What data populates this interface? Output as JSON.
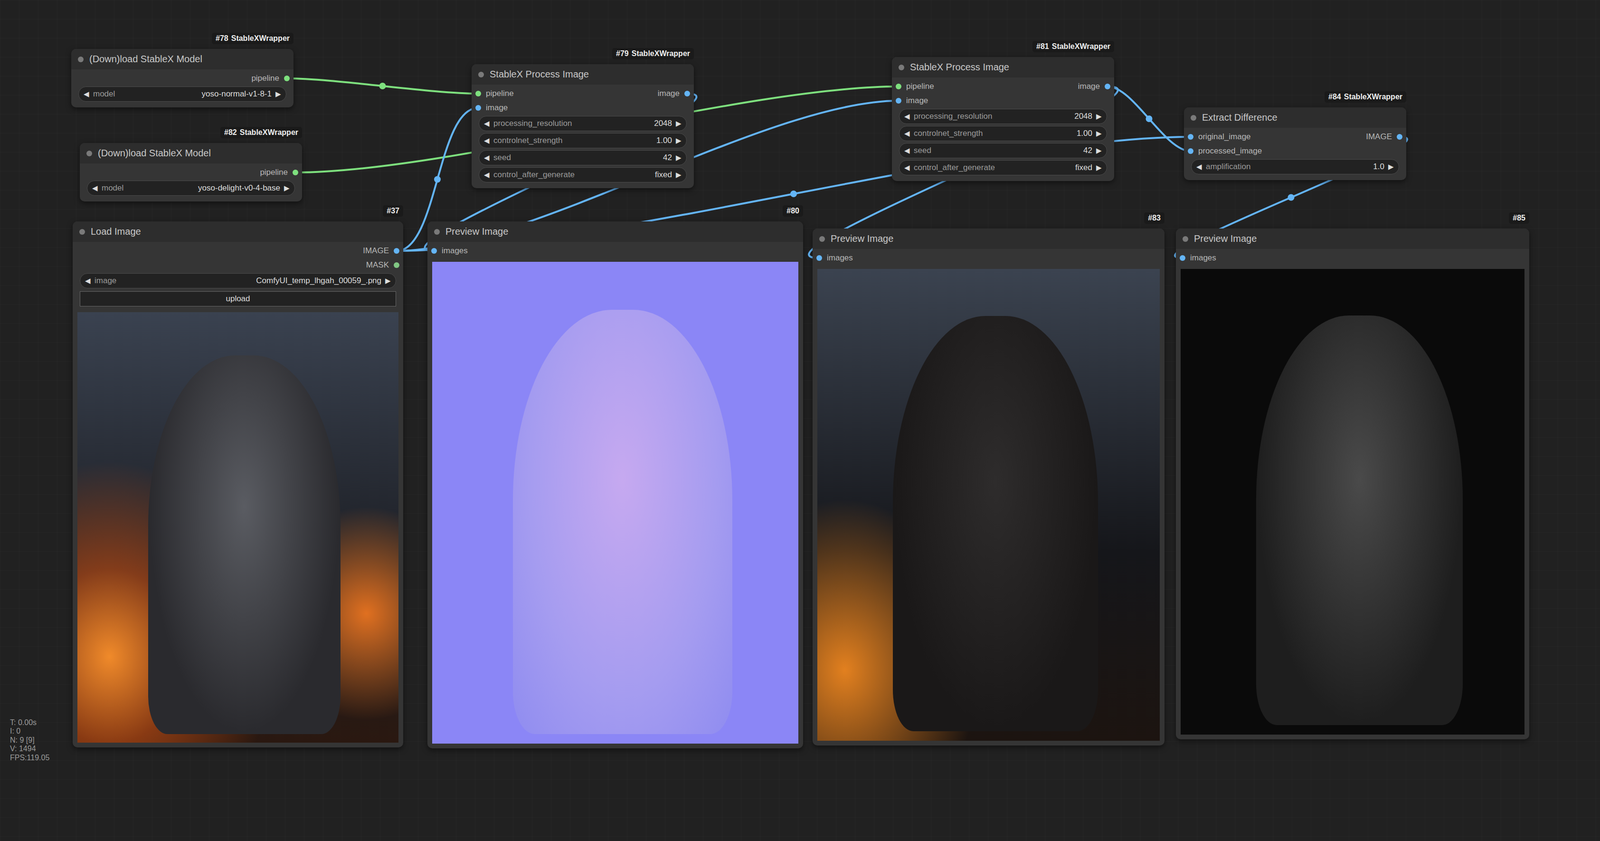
{
  "canvas": {
    "stats": [
      "T: 0.00s",
      "I: 0",
      "N: 9 [9]",
      "V: 1494",
      "FPS:119.05"
    ]
  },
  "widget_arrows": {
    "left": "◀",
    "right": "▶"
  },
  "nodes": [
    {
      "id": "#78",
      "source": "StableXWrapper",
      "title": "(Down)load StableX Model",
      "inputs": [],
      "outputs": [
        {
          "label": "pipeline",
          "color": "#7ee07e"
        }
      ],
      "widgets": [
        {
          "label": "model",
          "value": "yoso-normal-v1-8-1"
        }
      ],
      "button": "",
      "preview": ""
    },
    {
      "id": "#82",
      "source": "StableXWrapper",
      "title": "(Down)load StableX Model",
      "inputs": [],
      "outputs": [
        {
          "label": "pipeline",
          "color": "#7ee07e"
        }
      ],
      "widgets": [
        {
          "label": "model",
          "value": "yoso-delight-v0-4-base"
        }
      ],
      "button": "",
      "preview": ""
    },
    {
      "id": "#79",
      "source": "StableXWrapper",
      "title": "StableX Process Image",
      "inputs": [
        {
          "label": "pipeline",
          "color": "#7ee07e"
        },
        {
          "label": "image",
          "color": "#64b5f6"
        }
      ],
      "outputs": [
        {
          "label": "image",
          "color": "#64b5f6"
        }
      ],
      "widgets": [
        {
          "label": "processing_resolution",
          "value": "2048"
        },
        {
          "label": "controlnet_strength",
          "value": "1.00"
        },
        {
          "label": "seed",
          "value": "42"
        },
        {
          "label": "control_after_generate",
          "value": "fixed"
        }
      ],
      "button": "",
      "preview": ""
    },
    {
      "id": "#81",
      "source": "StableXWrapper",
      "title": "StableX Process Image",
      "inputs": [
        {
          "label": "pipeline",
          "color": "#7ee07e"
        },
        {
          "label": "image",
          "color": "#64b5f6"
        }
      ],
      "outputs": [
        {
          "label": "image",
          "color": "#64b5f6"
        }
      ],
      "widgets": [
        {
          "label": "processing_resolution",
          "value": "2048"
        },
        {
          "label": "controlnet_strength",
          "value": "1.00"
        },
        {
          "label": "seed",
          "value": "42"
        },
        {
          "label": "control_after_generate",
          "value": "fixed"
        }
      ],
      "button": "",
      "preview": ""
    },
    {
      "id": "#84",
      "source": "StableXWrapper",
      "title": "Extract Difference",
      "inputs": [
        {
          "label": "original_image",
          "color": "#64b5f6"
        },
        {
          "label": "processed_image",
          "color": "#64b5f6"
        }
      ],
      "outputs": [
        {
          "label": "IMAGE",
          "color": "#64b5f6"
        }
      ],
      "widgets": [
        {
          "label": "amplification",
          "value": "1.0"
        }
      ],
      "button": "",
      "preview": ""
    },
    {
      "id": "#37",
      "source": "",
      "title": "Load Image",
      "inputs": [],
      "outputs": [
        {
          "label": "IMAGE",
          "color": "#64b5f6"
        },
        {
          "label": "MASK",
          "color": "#81c784"
        }
      ],
      "widgets": [
        {
          "label": "image",
          "value": "ComfyUI_temp_lhgah_00059_.png"
        }
      ],
      "button": "upload",
      "preview": "photo"
    },
    {
      "id": "#80",
      "source": "",
      "title": "Preview Image",
      "inputs": [
        {
          "label": "images",
          "color": "#64b5f6"
        }
      ],
      "outputs": [],
      "widgets": [],
      "button": "",
      "preview": "normal-map"
    },
    {
      "id": "#83",
      "source": "",
      "title": "Preview Image",
      "inputs": [
        {
          "label": "images",
          "color": "#64b5f6"
        }
      ],
      "outputs": [],
      "widgets": [],
      "button": "",
      "preview": "delit"
    },
    {
      "id": "#85",
      "source": "",
      "title": "Preview Image",
      "inputs": [
        {
          "label": "images",
          "color": "#64b5f6"
        }
      ],
      "outputs": [],
      "widgets": [],
      "button": "",
      "preview": "difference"
    }
  ]
}
